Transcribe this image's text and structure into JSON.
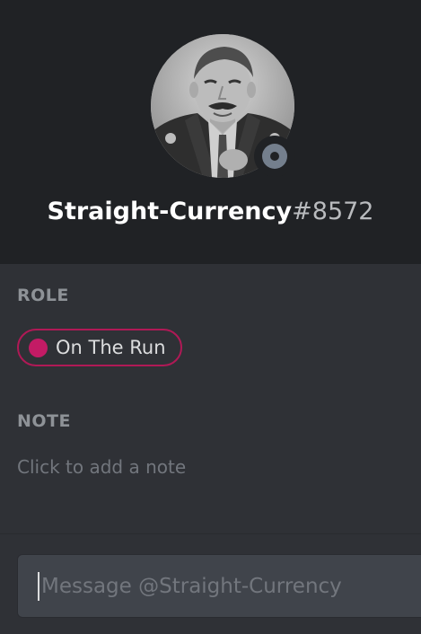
{
  "profile": {
    "username": "Straight-Currency",
    "discriminator": "#8572",
    "avatar_icon": "user-avatar-photo",
    "status_icon": "offline-status-icon",
    "status_color": "#747f8d"
  },
  "role_section": {
    "title": "ROLE",
    "roles": [
      {
        "name": "On The Run",
        "color": "#c31b65"
      }
    ]
  },
  "note_section": {
    "title": "NOTE",
    "placeholder": "Click to add a note"
  },
  "message": {
    "placeholder": "Message @Straight-Currency"
  }
}
